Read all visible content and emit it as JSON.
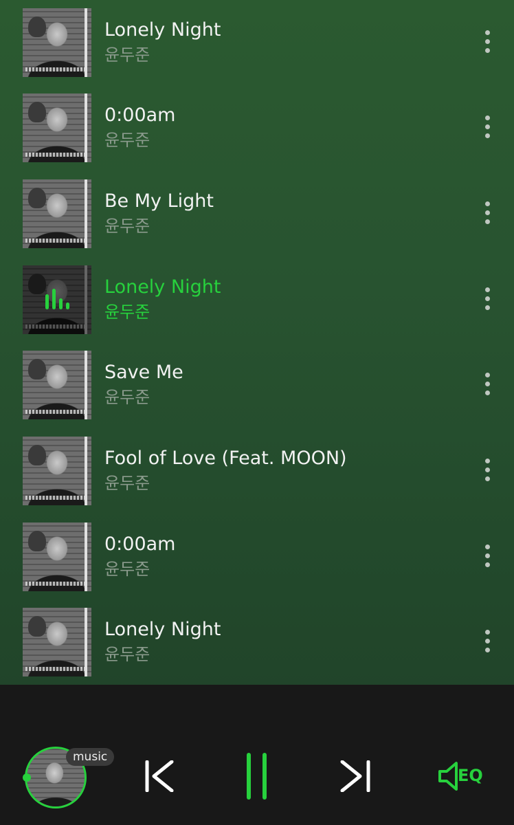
{
  "tracks": [
    {
      "title": "Lonely Night",
      "artist": "윤두준",
      "playing": false
    },
    {
      "title": "0:00am",
      "artist": "윤두준",
      "playing": false
    },
    {
      "title": "Be My Light",
      "artist": "윤두준",
      "playing": false
    },
    {
      "title": "Lonely Night",
      "artist": "윤두준",
      "playing": true
    },
    {
      "title": "Save Me",
      "artist": "윤두준",
      "playing": false
    },
    {
      "title": "Fool of Love (Feat. MOON)",
      "artist": "윤두준",
      "playing": false
    },
    {
      "title": "0:00am",
      "artist": "윤두준",
      "playing": false
    },
    {
      "title": "Lonely Night",
      "artist": "윤두준",
      "playing": false
    }
  ],
  "player": {
    "badge": "music",
    "eq_label": "EQ",
    "state": "playing"
  },
  "colors": {
    "accent": "#27d13d",
    "background_top": "#2b5a30",
    "player_bar": "#181818"
  },
  "icons": {
    "more": "more-vert-icon",
    "prev": "skip-previous-icon",
    "pause": "pause-icon",
    "next": "skip-next-icon",
    "eq": "equalizer-speaker-icon"
  }
}
